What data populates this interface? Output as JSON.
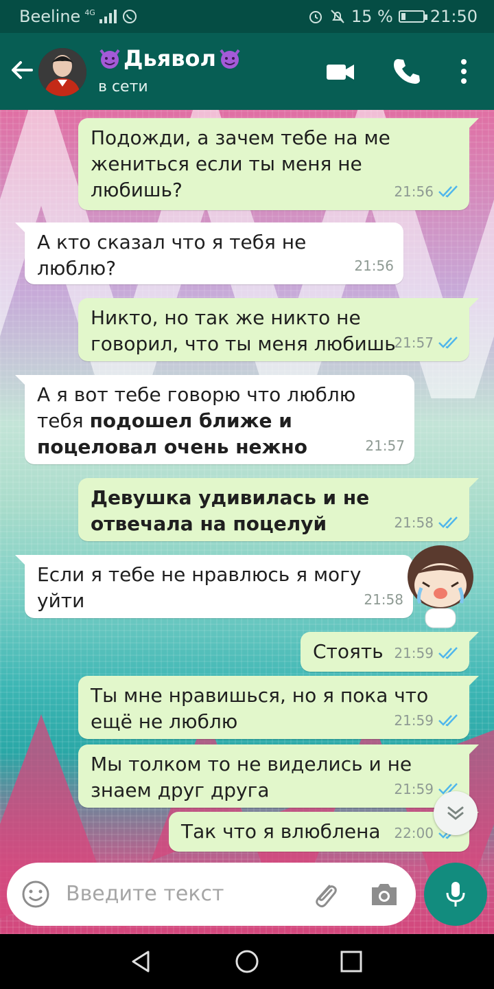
{
  "status_bar": {
    "carrier": "Beeline",
    "network": "4G",
    "battery": "15 %",
    "time": "21:50"
  },
  "header": {
    "contact_name": "Дьявол",
    "status": "в сети",
    "icons": [
      "back-arrow-icon",
      "video-call-icon",
      "phone-icon",
      "more-vert-icon"
    ]
  },
  "messages": [
    {
      "dir": "out",
      "text": "Подожди, а зачем тебе на ме жениться если ты меня не любишь?",
      "time": "21:56",
      "read": true
    },
    {
      "dir": "in",
      "text": "А кто сказал что я тебя не люблю?",
      "time": "21:56"
    },
    {
      "dir": "out",
      "text": "Никто, но так же никто не говорил, что ты меня любишь",
      "time": "21:57",
      "read": true
    },
    {
      "dir": "in",
      "text_plain": "А я вот тебе говорю что люблю тебя ",
      "text_bold": "подошел ближе и поцеловал очень нежно",
      "time": "21:57"
    },
    {
      "dir": "out",
      "text_bold": "Девушка удивилась и не отвечала на поцелуй",
      "time": "21:58",
      "read": true
    },
    {
      "dir": "in",
      "text": "Если я тебе не нравлюсь я могу уйти",
      "time": "21:58"
    },
    {
      "dir": "out",
      "text": "Стоять",
      "time": "21:59",
      "read": true
    },
    {
      "dir": "out",
      "text": "Ты мне нравишься, но я пока что ещё не люблю",
      "time": "21:59",
      "read": true
    },
    {
      "dir": "out",
      "text": "Мы толком то не виделись и не знаем друг друга",
      "time": "21:59",
      "read": true
    },
    {
      "dir": "out",
      "text": "Так что я влюблена",
      "time": "22:00",
      "read": true
    }
  ],
  "input": {
    "placeholder": "Введите текст"
  },
  "colors": {
    "header": "#075e54",
    "status_bar": "#054d44",
    "outgoing": "#e2f7cb",
    "incoming": "#ffffff",
    "read_ticks": "#4fb6ec",
    "mic_button": "#128c7e"
  }
}
